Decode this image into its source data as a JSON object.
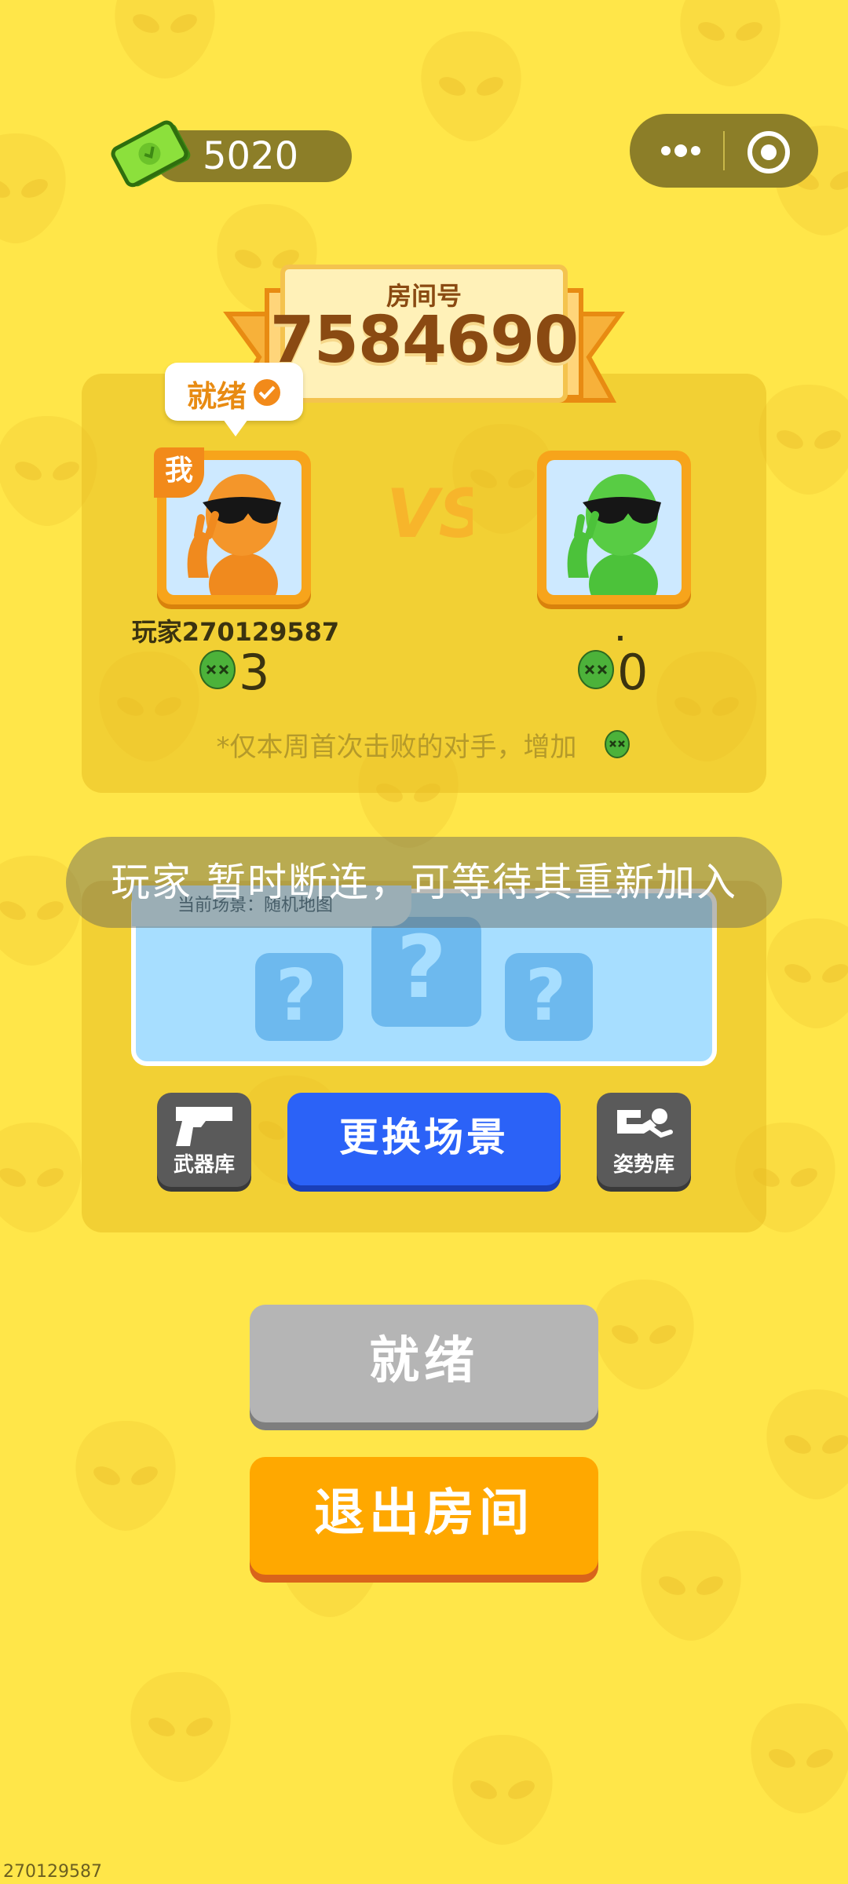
{
  "top_bar": {
    "cash_amount": "5020",
    "more_icon": "more-dots-icon",
    "close_icon": "target-circle-icon"
  },
  "room": {
    "label": "房间号",
    "number": "7584690"
  },
  "player": {
    "ready_label": "就绪",
    "me_badge": "我",
    "name": "玩家270129587",
    "kills": "3"
  },
  "opponent": {
    "name": ".",
    "kills": "0"
  },
  "vs_label": "VS",
  "hint": "*仅本周首次击败的对手，增加",
  "scene": {
    "current_label": "当前场景：随机地图",
    "question_mark": "?"
  },
  "toast": "玩家 暂时断连，可等待其重新加入",
  "tools": {
    "weapon_label": "武器库",
    "pose_label": "姿势库",
    "change_scene_label": "更换场景"
  },
  "buttons": {
    "ready": "就绪",
    "exit": "退出房间"
  },
  "footer_uid": "270129587",
  "colors": {
    "background": "#FFE649",
    "ready_orange": "#E88B12",
    "change_blue": "#2B62F7",
    "exit_orange": "#FFA800",
    "ready_gray": "#B5B5B5"
  }
}
